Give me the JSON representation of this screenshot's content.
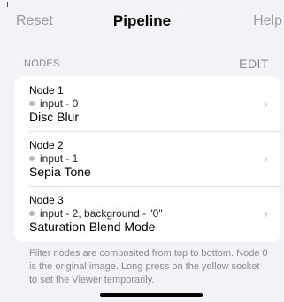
{
  "navbar": {
    "left_label": "Reset",
    "title": "Pipeline",
    "right_label": "Help"
  },
  "section": {
    "title": "NODES",
    "action_label": "EDIT"
  },
  "nodes": [
    {
      "title": "Node 1",
      "input": "input - 0",
      "filter": "Disc Blur"
    },
    {
      "title": "Node 2",
      "input": "input - 1",
      "filter": "Sepia Tone"
    },
    {
      "title": "Node 3",
      "input": "input - 2, background - \"0\"",
      "filter": "Saturation Blend Mode"
    }
  ],
  "footer": {
    "text": "Filter nodes are composited from top to bottom. Node 0 is the original image. Long press on the yellow socket to set the Viewer temporarily."
  },
  "icons": {
    "disclosure": "chevron-right-icon",
    "socket": "socket-dot-icon"
  },
  "colors": {
    "background": "#f2f2f7",
    "card": "#ffffff",
    "muted_text": "#8a8a8e",
    "chevron": "#c2c2c7",
    "socket_dot": "#b7b7bc"
  }
}
